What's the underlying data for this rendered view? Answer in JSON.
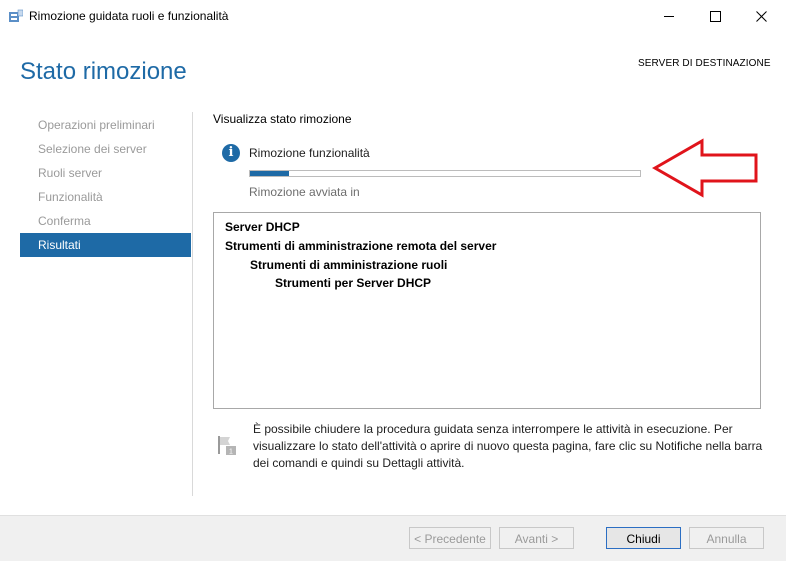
{
  "window": {
    "title": "Rimozione guidata ruoli e funzionalità"
  },
  "header": {
    "page_title": "Stato rimozione",
    "destination_label": "SERVER DI DESTINAZIONE"
  },
  "nav": {
    "items": [
      {
        "label": "Operazioni preliminari"
      },
      {
        "label": "Selezione dei server"
      },
      {
        "label": "Ruoli server"
      },
      {
        "label": "Funzionalità"
      },
      {
        "label": "Conferma"
      },
      {
        "label": "Risultati"
      }
    ]
  },
  "main": {
    "section_title": "Visualizza stato rimozione",
    "status_text": "Rimozione funzionalità",
    "progress_fraction": 0.1,
    "started_text": "Rimozione avviata in",
    "results": [
      {
        "text": "Server DHCP"
      },
      {
        "text": "Strumenti di amministrazione remota del server"
      },
      {
        "text": "Strumenti di amministrazione ruoli"
      },
      {
        "text": "Strumenti per Server DHCP"
      }
    ],
    "note": "È possibile chiudere la procedura guidata senza interrompere le attività in esecuzione. Per visualizzare lo stato dell'attività o aprire di nuovo questa pagina, fare clic su Notifiche nella barra dei comandi e quindi su Dettagli attività."
  },
  "buttons": {
    "previous": "< Precedente",
    "next": "Avanti >",
    "close": "Chiudi",
    "cancel": "Annulla"
  },
  "colors": {
    "accent": "#1e6aa6",
    "annotation_arrow": "#e0141b"
  }
}
